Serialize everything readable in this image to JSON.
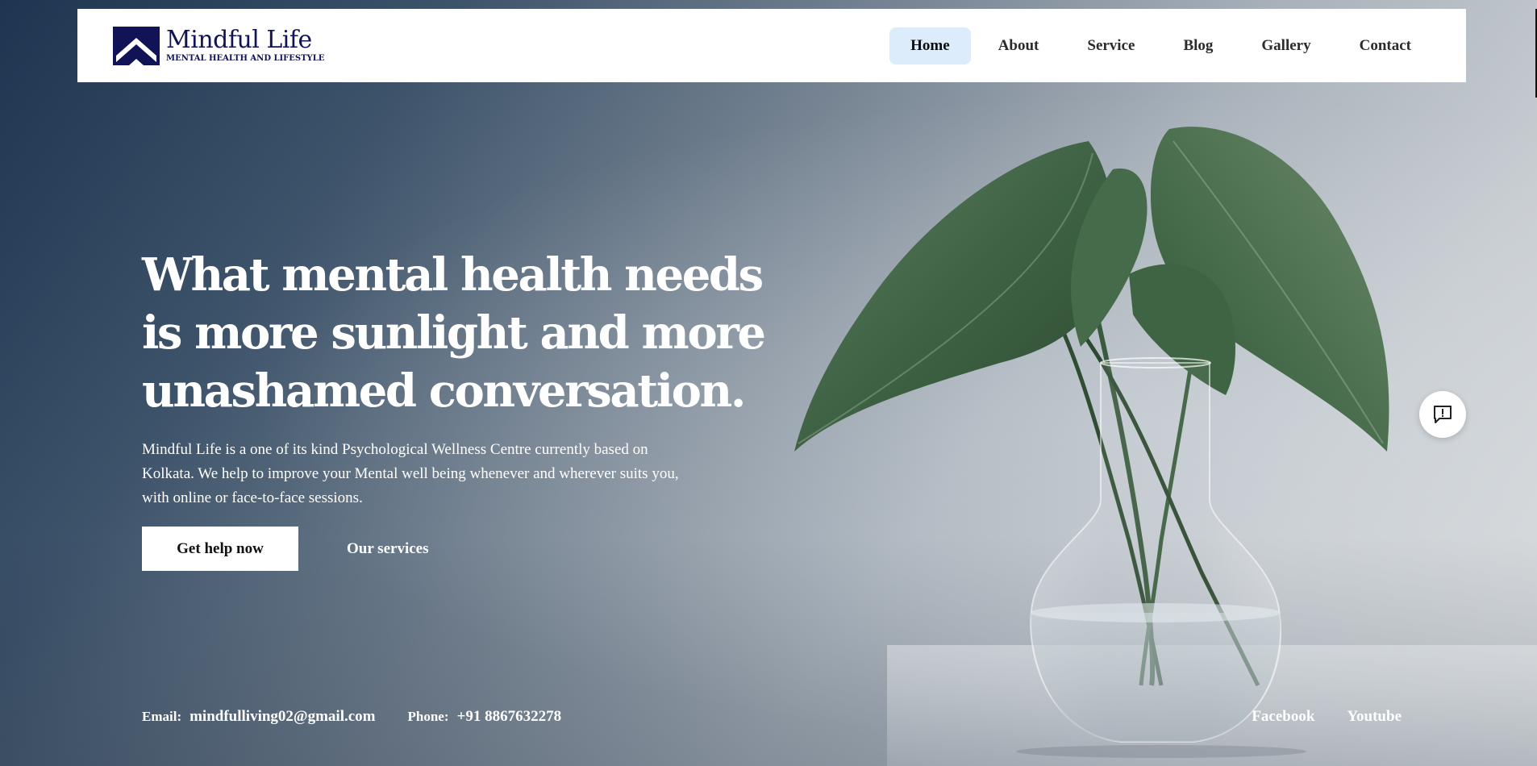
{
  "header": {
    "logo": {
      "name": "Mindful Life",
      "tagline": "MENTAL HEALTH AND LIFESTYLE",
      "icon": "mountain-chevron-logo"
    },
    "nav": [
      {
        "label": "Home",
        "active": true
      },
      {
        "label": "About",
        "active": false
      },
      {
        "label": "Service",
        "active": false
      },
      {
        "label": "Blog",
        "active": false
      },
      {
        "label": "Gallery",
        "active": false
      },
      {
        "label": "Contact",
        "active": false
      }
    ]
  },
  "hero": {
    "headline_lines": [
      "What mental health needs",
      "is more sunlight and more",
      "unashamed conversation."
    ],
    "description": "Mindful Life is a one of its kind Psychological Wellness Centre currently based on Kolkata. We help to improve your Mental well being whenever and wherever suits you, with online or face-to-face sessions.",
    "primary_button": "Get help now",
    "secondary_button": "Our services",
    "image": "plant-leaves-in-glass-vase"
  },
  "contact": {
    "email_label": "Email:",
    "email": "mindfulliving02@gmail.com",
    "phone_label": "Phone:",
    "phone": "+91 8867632278"
  },
  "social": {
    "facebook": "Facebook",
    "youtube": "Youtube"
  },
  "feedback": {
    "icon": "feedback-message-icon"
  },
  "colors": {
    "brand_navy": "#101456",
    "nav_active_bg": "#dcecfb",
    "hero_dark": "#1e3450",
    "hero_light": "#dadddf"
  }
}
